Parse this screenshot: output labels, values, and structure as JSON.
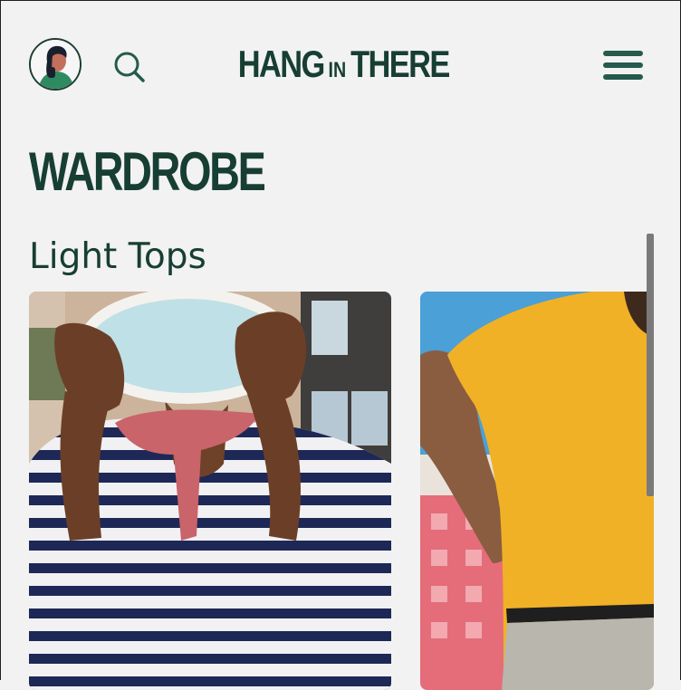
{
  "header": {
    "brand_main_1": "HANG",
    "brand_small": "IN",
    "brand_main_2": "THERE"
  },
  "page": {
    "title": "WARDROBE",
    "section": "Light Tops"
  },
  "icons": {
    "avatar": "avatar",
    "search": "search-icon",
    "menu": "menu-icon"
  },
  "colors": {
    "brand": "#173e33",
    "accent": "#255a4c",
    "background": "#f2f2f2"
  }
}
